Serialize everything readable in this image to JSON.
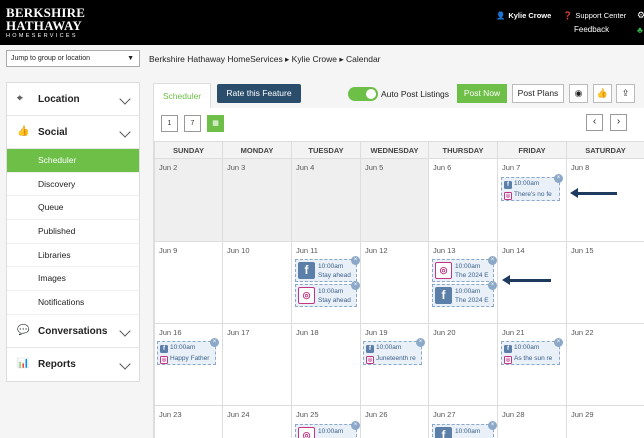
{
  "brand": {
    "line1": "BERKSHIRE",
    "line2": "HATHAWAY",
    "line3": "HOMESERVICES"
  },
  "header": {
    "user_name": "Kylie Crowe",
    "support": "Support Center",
    "feedback": "Feedback"
  },
  "jump": {
    "label": "Jump to group or location"
  },
  "breadcrumb": "Berkshire Hathaway HomeServices ▸ Kylie Crowe ▸ Calendar",
  "sidebar": {
    "location": "Location",
    "social": "Social",
    "social_items": [
      "Scheduler",
      "Discovery",
      "Queue",
      "Published",
      "Libraries",
      "Images",
      "Notifications"
    ],
    "conversations": "Conversations",
    "reports": "Reports"
  },
  "toolbar": {
    "tab_scheduler": "Scheduler",
    "rate": "Rate this Feature",
    "auto_post": "Auto Post Listings",
    "post_now": "Post Now",
    "post_plans": "Post Plans"
  },
  "calendar": {
    "days": [
      "SUNDAY",
      "MONDAY",
      "TUESDAY",
      "WEDNESDAY",
      "THURSDAY",
      "FRIDAY",
      "SATURDAY"
    ],
    "weeks": [
      [
        "Jun 2",
        "Jun 3",
        "Jun 4",
        "Jun 5",
        "Jun 6",
        "Jun 7",
        "Jun 8"
      ],
      [
        "Jun 9",
        "Jun 10",
        "Jun 11",
        "Jun 12",
        "Jun 13",
        "Jun 14",
        "Jun 15"
      ],
      [
        "Jun 16",
        "Jun 17",
        "Jun 18",
        "Jun 19",
        "Jun 20",
        "Jun 21",
        "Jun 22"
      ],
      [
        "Jun 23",
        "Jun 24",
        "Jun 25",
        "Jun 26",
        "Jun 27",
        "Jun 28",
        "Jun 29"
      ]
    ],
    "posts": {
      "jun7": {
        "time": "10:00am",
        "text": "There's no fe"
      },
      "jun11_fb": {
        "time": "10:00am",
        "text": "Stay ahead"
      },
      "jun11_ig": {
        "time": "10:00am",
        "text": "Stay ahead"
      },
      "jun13_ig": {
        "time": "10:00am",
        "text": "The 2024 E"
      },
      "jun13_fb": {
        "time": "10:00am",
        "text": "The 2024 E"
      },
      "jun16": {
        "time": "10:00am",
        "text": "Happy Father"
      },
      "jun19": {
        "time": "10:00am",
        "text": "Juneteenth re"
      },
      "jun21": {
        "time": "10:00am",
        "text": "As the sun re"
      },
      "jun25": {
        "time": "10:00am"
      },
      "jun27": {
        "time": "10:00am"
      }
    }
  },
  "colors": {
    "accent": "#6dbf47",
    "navy": "#2a4d6b",
    "arrow": "#1e3a5f"
  }
}
